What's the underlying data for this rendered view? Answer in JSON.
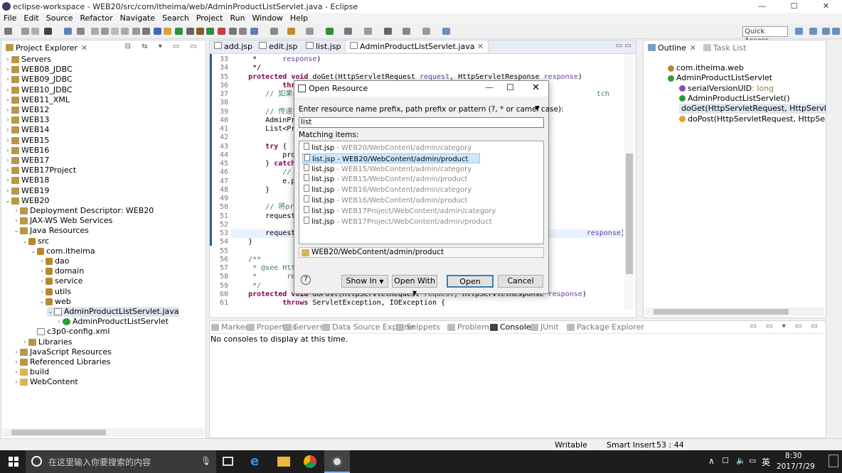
{
  "window": {
    "title": "eclipse-workspace - WEB20/src/com/itheima/web/AdminProductListServlet.java - Eclipse",
    "min": "—",
    "max": "☐",
    "close": "✕"
  },
  "menu": [
    "File",
    "Edit",
    "Source",
    "Refactor",
    "Navigate",
    "Search",
    "Project",
    "Run",
    "Window",
    "Help"
  ],
  "toolbar": {
    "quick_access": "Quick Access"
  },
  "project_explorer": {
    "tab_label": "Project Explorer",
    "items": [
      {
        "label": "Servers",
        "depth": 0,
        "arrow": "›",
        "icon": "proj"
      },
      {
        "label": "WEB08_JDBC",
        "depth": 0,
        "arrow": "›",
        "icon": "proj"
      },
      {
        "label": "WEB09_JDBC",
        "depth": 0,
        "arrow": "›",
        "icon": "proj"
      },
      {
        "label": "WEB10_JDBC",
        "depth": 0,
        "arrow": "›",
        "icon": "proj"
      },
      {
        "label": "WEB11_XML",
        "depth": 0,
        "arrow": "›",
        "icon": "proj"
      },
      {
        "label": "WEB12",
        "depth": 0,
        "arrow": "›",
        "icon": "proj"
      },
      {
        "label": "WEB13",
        "depth": 0,
        "arrow": "›",
        "icon": "proj"
      },
      {
        "label": "WEB14",
        "depth": 0,
        "arrow": "›",
        "icon": "proj"
      },
      {
        "label": "WEB15",
        "depth": 0,
        "arrow": "›",
        "icon": "proj"
      },
      {
        "label": "WEB16",
        "depth": 0,
        "arrow": "›",
        "icon": "proj"
      },
      {
        "label": "WEB17",
        "depth": 0,
        "arrow": "›",
        "icon": "proj"
      },
      {
        "label": "WEB17Project",
        "depth": 0,
        "arrow": "›",
        "icon": "proj"
      },
      {
        "label": "WEB18",
        "depth": 0,
        "arrow": "›",
        "icon": "proj"
      },
      {
        "label": "WEB19",
        "depth": 0,
        "arrow": "›",
        "icon": "proj"
      },
      {
        "label": "WEB20",
        "depth": 0,
        "arrow": "⌄",
        "icon": "proj"
      },
      {
        "label": "Deployment Descriptor: WEB20",
        "depth": 1,
        "arrow": "›",
        "icon": "proj"
      },
      {
        "label": "JAX-WS Web Services",
        "depth": 1,
        "arrow": "›",
        "icon": "proj"
      },
      {
        "label": "Java Resources",
        "depth": 1,
        "arrow": "⌄",
        "icon": "proj"
      },
      {
        "label": "src",
        "depth": 2,
        "arrow": "⌄",
        "icon": "pkg"
      },
      {
        "label": "com.itheima",
        "depth": 3,
        "arrow": "⌄",
        "icon": "pkg"
      },
      {
        "label": "dao",
        "depth": 4,
        "arrow": "›",
        "icon": "pkg"
      },
      {
        "label": "domain",
        "depth": 4,
        "arrow": "›",
        "icon": "pkg"
      },
      {
        "label": "service",
        "depth": 4,
        "arrow": "›",
        "icon": "pkg"
      },
      {
        "label": "utils",
        "depth": 4,
        "arrow": "›",
        "icon": "pkg"
      },
      {
        "label": "web",
        "depth": 4,
        "arrow": "⌄",
        "icon": "pkg"
      },
      {
        "label": "AdminProductListServlet.java",
        "depth": 5,
        "arrow": "⌄",
        "icon": "jav"
      },
      {
        "label": "AdminProductListServlet",
        "depth": 6,
        "arrow": "›",
        "icon": "cls"
      },
      {
        "label": "c3p0-config.xml",
        "depth": 3,
        "arrow": "",
        "icon": "jav"
      },
      {
        "label": "Libraries",
        "depth": 2,
        "arrow": "›",
        "icon": "proj"
      },
      {
        "label": "JavaScript Resources",
        "depth": 1,
        "arrow": "›",
        "icon": "proj"
      },
      {
        "label": "Referenced Libraries",
        "depth": 1,
        "arrow": "›",
        "icon": "proj"
      },
      {
        "label": "build",
        "depth": 1,
        "arrow": "›",
        "icon": "fold"
      },
      {
        "label": "WebContent",
        "depth": 1,
        "arrow": "›",
        "icon": "fold"
      }
    ]
  },
  "editor": {
    "tabs": [
      {
        "label": "add.jsp"
      },
      {
        "label": "edit.jsp"
      },
      {
        "label": "list.jsp"
      },
      {
        "label": "AdminProductListServlet.java",
        "active": true
      }
    ],
    "lines": [
      {
        "n": "33",
        "html": "     *      <span class='pr'>response</span>)"
      },
      {
        "n": "34",
        "html": "     */"
      },
      {
        "n": "35",
        "html": "    <span class='kw'>protected</span> <span class='kw'>void</span> doGet(HttpServletRequest <span class='pr'>request</span>, HttpServletResponse <span class='pr'>response</span>)"
      },
      {
        "n": "36",
        "html": "            <span class='kw'>throw</span>"
      },
      {
        "n": "37",
        "html": "        <span class='cm'>// 如果se</span>                                                                     <span class='cm'>tch</span>"
      },
      {
        "n": "38",
        "html": ""
      },
      {
        "n": "39",
        "html": "        <span class='cm'>// 传递请</span>"
      },
      {
        "n": "40",
        "html": "        AdminProd"
      },
      {
        "n": "41",
        "html": "        List&lt;Prod"
      },
      {
        "n": "42",
        "html": ""
      },
      {
        "n": "43",
        "html": "        <span class='kw'>try</span> {"
      },
      {
        "n": "44",
        "html": "            produ"
      },
      {
        "n": "45",
        "html": "        } <span class='kw'>catch</span> ("
      },
      {
        "n": "46",
        "html": "            <span class='cm'>// TO</span>"
      },
      {
        "n": "47",
        "html": "            e.pri"
      },
      {
        "n": "48",
        "html": "        }"
      },
      {
        "n": "49",
        "html": ""
      },
      {
        "n": "50",
        "html": "        <span class='cm'>// 将proc</span>"
      },
      {
        "n": "51",
        "html": "        request.s"
      },
      {
        "n": "52",
        "html": ""
      },
      {
        "n": "53",
        "html": "        request.g                                                                  <span class='pr'>response</span>);"
      },
      {
        "n": "54",
        "html": "    }"
      },
      {
        "n": "55",
        "html": ""
      },
      {
        "n": "56",
        "html": "    <span class='cm'>/**</span>"
      },
      {
        "n": "57",
        "html": "     <span class='cm'>* @see HttpS</span>"
      },
      {
        "n": "58",
        "html": "     <span class='cm'>*       respo</span>"
      },
      {
        "n": "59",
        "html": "     <span class='cm'>*/</span>"
      },
      {
        "n": "60",
        "html": "    <span class='kw'>protected</span> <span class='kw'>void</span> doPost(HttpServletRequest <span class='pr'>request</span>, HttpServletResponse <span class='pr'>response</span>)"
      },
      {
        "n": "61",
        "html": "            <span class='kw'>throws</span> ServletException, IOException {"
      }
    ]
  },
  "outline": {
    "tabs": {
      "outline": "Outline",
      "tasklist": "Task List"
    },
    "items": [
      {
        "label": "com.itheima.web",
        "x": 20,
        "type": ""
      },
      {
        "label": "AdminProductListServlet",
        "x": 20,
        "type": ""
      },
      {
        "label": "serialVersionUID",
        "x": 36,
        "type": " : long"
      },
      {
        "label": "AdminProductListServlet()",
        "x": 36,
        "type": ""
      },
      {
        "label": "doGet(HttpServletRequest, HttpServletRespo",
        "x": 36,
        "type": "",
        "selected": true
      },
      {
        "label": "doPost(HttpServletRequest, HttpServletRespo",
        "x": 36,
        "type": ""
      }
    ]
  },
  "bottom": {
    "tabs": [
      "Markers",
      "Properties",
      "Servers",
      "Data Source Explorer",
      "Snippets",
      "Problems",
      "Console",
      "JUnit",
      "Package Explorer"
    ],
    "active_tab": "Console",
    "console_text": "No consoles to display at this time."
  },
  "dialog": {
    "title": "Open Resource",
    "prompt": "Enter resource name prefix, path prefix or pattern (?, * or camel case):",
    "input_value": "list",
    "matching_label": "Matching items:",
    "matches": [
      {
        "name": "list.jsp",
        "path": " - WEB20/WebContent/admin/category"
      },
      {
        "name": "list.jsp",
        "path": " - WEB20/WebContent/admin/product",
        "selected": true
      },
      {
        "name": "list.jsp",
        "path": " - WEB15/WebContent/admin/category"
      },
      {
        "name": "list.jsp",
        "path": " - WEB15/WebContent/admin/product"
      },
      {
        "name": "list.jsp",
        "path": " - WEB16/WebContent/admin/category"
      },
      {
        "name": "list.jsp",
        "path": " - WEB16/WebContent/admin/product"
      },
      {
        "name": "list.jsp",
        "path": " - WEB17Project/WebContent/admin/category"
      },
      {
        "name": "list.jsp",
        "path": " - WEB17Project/WebContent/admin/product"
      }
    ],
    "selected_path": "WEB20/WebContent/admin/product",
    "help": "?",
    "show_in": "Show In",
    "open_with": "Open With",
    "open": "Open",
    "cancel": "Cancel"
  },
  "status": {
    "writable": "Writable",
    "insert": "Smart Insert",
    "position": "53 : 44"
  },
  "taskbar": {
    "search_placeholder": "在这里输入你要搜索的内容",
    "time": "8:30",
    "date": "2017/7/29",
    "ime": "英"
  }
}
